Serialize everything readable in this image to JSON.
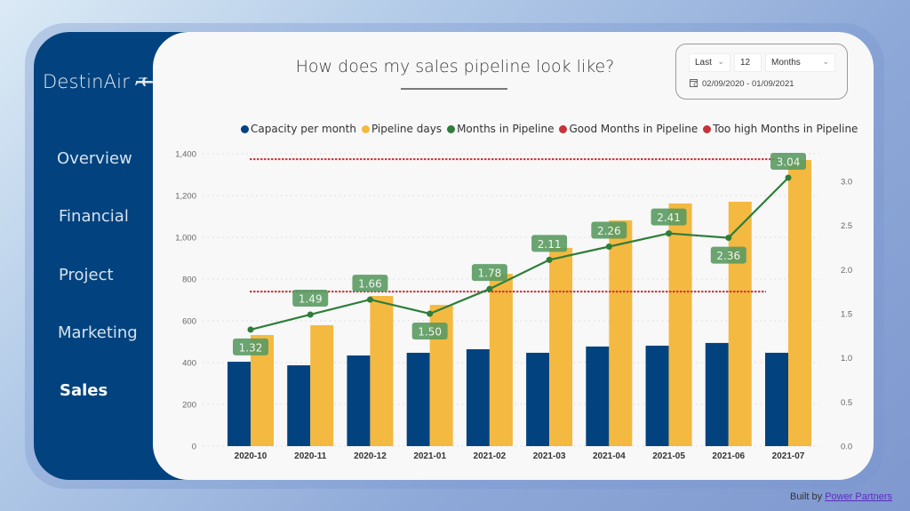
{
  "app": {
    "brand": "DestinAir",
    "brand_icon": "airplane-icon"
  },
  "sidebar": {
    "items": [
      {
        "label": "Overview",
        "active": false
      },
      {
        "label": "Financial",
        "active": false
      },
      {
        "label": "Project",
        "active": false
      },
      {
        "label": "Marketing",
        "active": false
      },
      {
        "label": "Sales",
        "active": true
      }
    ]
  },
  "header": {
    "title": "How does my sales pipeline look like?"
  },
  "filter": {
    "period_mode": "Last",
    "period_count": "12",
    "period_unit": "Months",
    "date_range": "02/09/2020 - 01/09/2021",
    "calendar_icon": "calendar-icon"
  },
  "footer": {
    "prefix": "Built by",
    "link": "Power Partners"
  },
  "colors": {
    "capacity": "#02437f",
    "pipeline_days": "#f4b940",
    "months": "#2e7d3a",
    "label_bg": "#5a9a62",
    "good": "#c8323a",
    "too_high": "#c8323a"
  },
  "chart_data": {
    "type": "bar",
    "title": "How does my sales pipeline look like?",
    "categories": [
      "2020-10",
      "2020-11",
      "2020-12",
      "2021-01",
      "2021-02",
      "2021-03",
      "2021-04",
      "2021-05",
      "2021-06",
      "2021-07"
    ],
    "series": [
      {
        "name": "Capacity per month",
        "type": "bar",
        "axis": "left",
        "values": [
          404,
          387,
          434,
          447,
          464,
          447,
          477,
          481,
          494,
          447
        ]
      },
      {
        "name": "Pipeline days",
        "type": "bar",
        "axis": "left",
        "values": [
          532,
          579,
          719,
          676,
          825,
          949,
          1081,
          1162,
          1170,
          1370
        ]
      },
      {
        "name": "Months in Pipeline",
        "type": "line",
        "axis": "right",
        "values": [
          1.32,
          1.49,
          1.66,
          1.5,
          1.78,
          2.11,
          2.26,
          2.41,
          2.36,
          3.04
        ],
        "labels": [
          "1.32",
          "1.49",
          "1.66",
          "1.50",
          "1.78",
          "2.11",
          "2.26",
          "2.41",
          "2.36",
          "3.04"
        ]
      },
      {
        "name": "Good Months in Pipeline",
        "type": "reference-line",
        "axis": "right",
        "value": 1.75
      },
      {
        "name": "Too high Months in Pipeline",
        "type": "reference-line",
        "axis": "right",
        "value": 3.25
      }
    ],
    "legend": [
      "Capacity per month",
      "Pipeline days",
      "Months in Pipeline",
      "Good Months in Pipeline",
      "Too high Months in Pipeline"
    ],
    "legend_position": "top",
    "y_left": {
      "ylim": [
        0,
        1400
      ],
      "ticks": [
        "0",
        "200",
        "400",
        "600",
        "800",
        "1,000",
        "1,200",
        "1,400"
      ]
    },
    "y_right": {
      "ylim": [
        0,
        3.3
      ],
      "ticks": [
        "0.0",
        "0.5",
        "1.0",
        "1.5",
        "2.0",
        "2.5",
        "3.0"
      ]
    },
    "grid": true
  }
}
